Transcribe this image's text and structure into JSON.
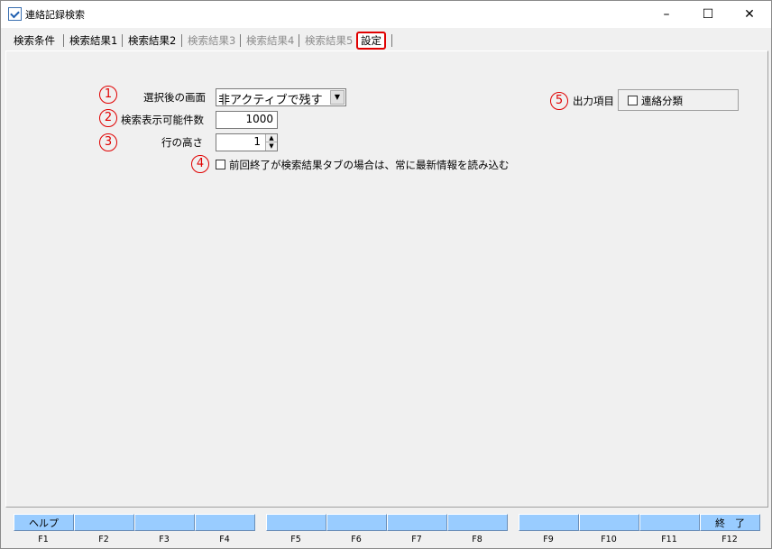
{
  "window": {
    "title": "連絡記録検索",
    "minimize": "–",
    "maximize": "☐",
    "close": "✕"
  },
  "tabs": [
    {
      "label": "検索条件",
      "state": "normal"
    },
    {
      "label": "検索結果1",
      "state": "normal"
    },
    {
      "label": "検索結果2",
      "state": "normal"
    },
    {
      "label": "検索結果3",
      "state": "disabled"
    },
    {
      "label": "検索結果4",
      "state": "disabled"
    },
    {
      "label": "検索結果5",
      "state": "disabled"
    },
    {
      "label": "設定",
      "state": "active"
    }
  ],
  "settings": {
    "marker1": "1",
    "marker2": "2",
    "marker3": "3",
    "marker4": "4",
    "marker5": "5",
    "screen_after_select_label": "選択後の画面",
    "screen_after_select_value": "非アクティブで残す",
    "max_results_label": "検索表示可能件数",
    "max_results_value": "1000",
    "row_height_label": "行の高さ",
    "row_height_value": "1",
    "reload_checkbox_label": "前回終了が検索結果タブの場合は、常に最新情報を読み込む",
    "reload_checked": false,
    "output_items_label": "出力項目",
    "output_category_label": "連絡分類",
    "output_category_checked": false
  },
  "function_keys": [
    {
      "label": "ヘルプ",
      "key": "F1"
    },
    {
      "label": "",
      "key": "F2"
    },
    {
      "label": "",
      "key": "F3"
    },
    {
      "label": "",
      "key": "F4"
    },
    {
      "label": "",
      "key": "F5"
    },
    {
      "label": "",
      "key": "F6"
    },
    {
      "label": "",
      "key": "F7"
    },
    {
      "label": "",
      "key": "F8"
    },
    {
      "label": "",
      "key": "F9"
    },
    {
      "label": "",
      "key": "F10"
    },
    {
      "label": "",
      "key": "F11"
    },
    {
      "label": "終　了",
      "key": "F12"
    }
  ],
  "colors": {
    "fkey_bg": "#99ccff",
    "highlight_red": "#e00000"
  }
}
